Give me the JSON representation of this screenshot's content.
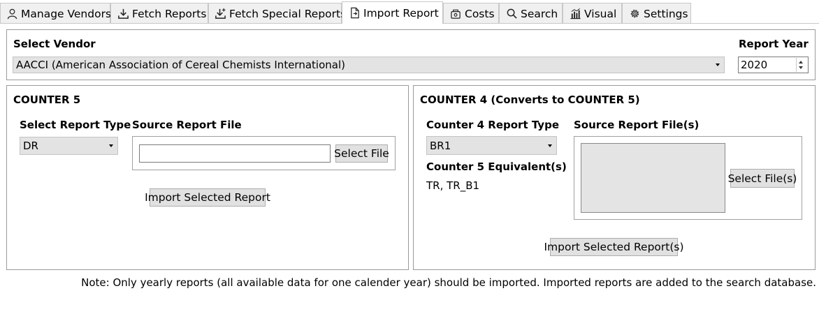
{
  "tabs": [
    {
      "label": "Manage Vendors",
      "icon": "user-icon"
    },
    {
      "label": "Fetch Reports",
      "icon": "download-icon"
    },
    {
      "label": "Fetch Special Reports",
      "icon": "download-plus-icon"
    },
    {
      "label": "Import Report",
      "icon": "document-import-icon"
    },
    {
      "label": "Costs",
      "icon": "costs-icon"
    },
    {
      "label": "Search",
      "icon": "search-icon"
    },
    {
      "label": "Visual",
      "icon": "chart-icon"
    },
    {
      "label": "Settings",
      "icon": "gear-icon"
    }
  ],
  "active_tab": "Import Report",
  "vendor": {
    "label": "Select Vendor",
    "selected": "AACCI (American Association of Cereal Chemists International)"
  },
  "year": {
    "label": "Report Year",
    "value": "2020"
  },
  "counter5": {
    "title": "COUNTER 5",
    "report_type_label": "Select Report Type",
    "report_type_value": "DR",
    "source_label": "Source Report File",
    "source_value": "",
    "select_file_button": "Select File",
    "import_button": "Import Selected Report"
  },
  "counter4": {
    "title": "COUNTER 4 (Converts to COUNTER 5)",
    "report_type_label": "Counter 4 Report Type",
    "report_type_value": "BR1",
    "equivalent_label": "Counter 5 Equivalent(s)",
    "equivalent_value": "TR, TR_B1",
    "source_label": "Source Report File(s)",
    "select_files_button": "Select File(s)",
    "import_button": "Import Selected Report(s)"
  },
  "note": "Note: Only yearly reports (all available data for one calender year) should be imported. Imported reports are added to the search database."
}
